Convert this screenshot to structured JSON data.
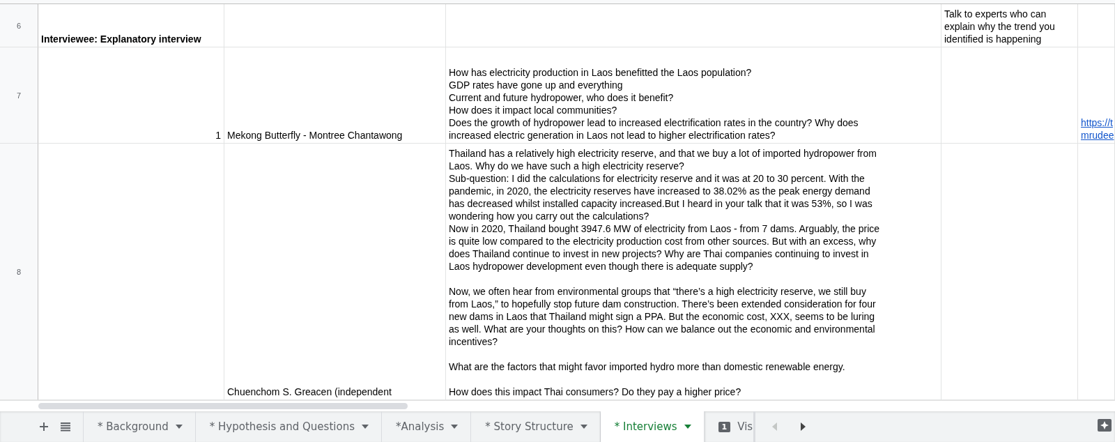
{
  "rows": [
    {
      "number": "6",
      "column_a": {
        "text": "Interviewee: Explanatory interview",
        "kind": "bold"
      },
      "column_d": {
        "text": "Talk to experts who can\nexplain why the trend you\nidentified is happening",
        "kind": "text"
      }
    },
    {
      "number": "7",
      "column_a": {
        "text": "1",
        "kind": "number"
      },
      "column_b": {
        "text": "Mekong Butterfly - Montree Chantawong",
        "kind": "text"
      },
      "column_c": {
        "text": "How has electricity production in Laos benefitted the Laos population?\nGDP rates have gone up and everything\nCurrent and future hydropower, who does it benefit?\nHow does it impact local communities?\nDoes the growth of hydropower lead to increased electrification rates in the country? Why does\nincreased electric generation in Laos not lead to higher electrification rates?",
        "kind": "text"
      },
      "column_e": {
        "text": "https://t\nmrudee",
        "kind": "link"
      }
    },
    {
      "number": "8",
      "column_b": {
        "text": "Chuenchom S. Greacen (independent",
        "kind": "text"
      },
      "column_c": {
        "text": "Thailand has a relatively high electricity reserve, and that we buy a lot of imported hydropower from\nLaos. Why do we have such a high electricity reserve?\nSub-question: I did the calculations for electricity reserve and it was at 20 to 30 percent. With the\npandemic, in 2020, the electricity reserves have increased to 38.02% as the peak energy demand\nhas decreased whilst installed capacity increased.But I heard in your talk that it was 53%, so I was\nwondering how you carry out the calculations?\nNow in 2020, Thailand bought 3947.6 MW of electricity from Laos - from 7 dams. Arguably, the price\nis quite low compared to the electricity production cost from other sources. But with an excess, why\ndoes Thailand continue to invest in new projects? Why are Thai companies continuing to invest in\nLaos hydropower development even though there is adequate supply?\n\nNow, we often hear from environmental groups that “there’s a high electricity reserve, we still buy\nfrom Laos,” to hopefully stop future dam construction. There’s been extended consideration for four\nnew dams in Laos that Thailand might sign a PPA. But the economic cost, XXX, seems to be luring\nas well. What are your thoughts on this? How can we balance out the economic and environmental\nincentives?\n\nWhat are the factors that might favor imported hydro more than domestic renewable energy.\n\nHow does this impact Thai consumers? Do they pay a higher price?",
        "kind": "text"
      }
    }
  ],
  "sheet_tabs": [
    {
      "label": "* Background",
      "selected": false
    },
    {
      "label": "* Hypothesis and Questions",
      "selected": false
    },
    {
      "label": "*Analysis",
      "selected": false
    },
    {
      "label": "* Story Structure",
      "selected": false
    },
    {
      "label": "* Interviews",
      "selected": true
    },
    {
      "label": "Vis",
      "selected": false,
      "comment_count": "1"
    }
  ]
}
